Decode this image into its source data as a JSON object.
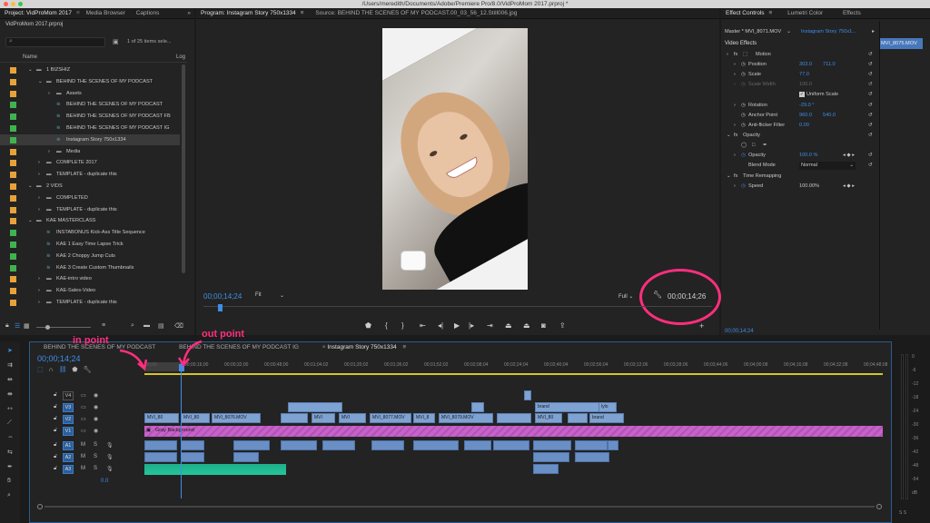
{
  "titlebar": {
    "path": "/Users/meredith/Documents/Adobe/Premiere Pro/8.0/VidProMom 2017.prproj *"
  },
  "project_panel": {
    "tabs": [
      "Project: VidProMom 2017",
      "Media Browser",
      "Captions"
    ],
    "file_name": "VidProMom 2017.prproj",
    "item_count": "1 of 25 items sele...",
    "col_name": "Name",
    "col_log": "Log",
    "rows": [
      {
        "label": "1 BIZSHIZ",
        "indent": 1,
        "type": "folder",
        "open": true,
        "color": "#e8a23a"
      },
      {
        "label": "BEHIND THE SCENES OF MY PODCAST",
        "indent": 2,
        "type": "folder",
        "open": true,
        "color": "#e8a23a"
      },
      {
        "label": "Assets",
        "indent": 3,
        "type": "folder",
        "open": false,
        "color": "#e8a23a"
      },
      {
        "label": "BEHIND THE SCENES OF MY PODCAST",
        "indent": 3,
        "type": "seq",
        "color": "#3fb34f"
      },
      {
        "label": "BEHIND THE SCENES OF MY PODCAST FB",
        "indent": 3,
        "type": "seq",
        "color": "#3fb34f"
      },
      {
        "label": "BEHIND THE SCENES OF MY PODCAST IG",
        "indent": 3,
        "type": "seq",
        "color": "#3fb34f"
      },
      {
        "label": "Instagram Story 750x1334",
        "indent": 3,
        "type": "seq",
        "color": "#3fb34f",
        "selected": true
      },
      {
        "label": "Media",
        "indent": 3,
        "type": "folder",
        "open": false,
        "color": "#e8a23a"
      },
      {
        "label": "COMPLETE 2017",
        "indent": 2,
        "type": "folder",
        "open": false,
        "color": "#e8a23a"
      },
      {
        "label": "TEMPLATE - duplicate this",
        "indent": 2,
        "type": "folder",
        "open": false,
        "color": "#e8a23a"
      },
      {
        "label": "2 VIDS",
        "indent": 1,
        "type": "folder",
        "open": true,
        "color": "#e8a23a"
      },
      {
        "label": "COMPLETED",
        "indent": 2,
        "type": "folder",
        "open": false,
        "color": "#e8a23a"
      },
      {
        "label": "TEMPLATE - duplicate this",
        "indent": 2,
        "type": "folder",
        "open": false,
        "color": "#e8a23a"
      },
      {
        "label": "KAE MASTERCLASS",
        "indent": 1,
        "type": "folder",
        "open": true,
        "color": "#e8a23a"
      },
      {
        "label": "INSTABONUS Kick-Ass Title Sequence",
        "indent": 2,
        "type": "seq",
        "color": "#3fb34f"
      },
      {
        "label": "KAE 1 Easy Time Lapse Trick",
        "indent": 2,
        "type": "seq",
        "color": "#3fb34f"
      },
      {
        "label": "KAE 2 Choppy Jump Cuts",
        "indent": 2,
        "type": "seq",
        "color": "#3fb34f"
      },
      {
        "label": "KAE 3 Create Custom Thumbnails",
        "indent": 2,
        "type": "seq",
        "color": "#3fb34f"
      },
      {
        "label": "KAE-intro video",
        "indent": 2,
        "type": "folder",
        "open": false,
        "color": "#e8a23a"
      },
      {
        "label": "KAE-Sales-Video",
        "indent": 2,
        "type": "folder",
        "open": false,
        "color": "#e8a23a"
      },
      {
        "label": "TEMPLATE - duplicate this",
        "indent": 2,
        "type": "folder",
        "open": false,
        "color": "#e8a23a"
      }
    ]
  },
  "program_monitor": {
    "tab_program": "Program: Instagram Story 750x1334",
    "tab_source": "Source: BEHIND THE SCENES OF MY PODCAST.00_03_56_12.Still006.jpg",
    "timecode_left": "00;00;14;24",
    "fit": "Fit",
    "quality": "Full",
    "timecode_right": "00;00;14;26"
  },
  "effect_controls": {
    "tabs": [
      "Effect Controls",
      "Lumetri Color",
      "Effects"
    ],
    "master": "Master * MVI_8071.MOV",
    "sequence": "Instagram Story 750x1...",
    "clip_chip": "MVI_8075.MOV",
    "video_effects": "Video Effects",
    "motion": "Motion",
    "position_label": "Position",
    "position_x": "303.0",
    "position_y": "711.0",
    "scale_label": "Scale",
    "scale_value": "77.0",
    "scale_width_label": "Scale Width",
    "scale_width_value": "100.0",
    "uniform_scale": "Uniform Scale",
    "rotation_label": "Rotation",
    "rotation_value": "-29.0 °",
    "anchor_label": "Anchor Point",
    "anchor_x": "960.0",
    "anchor_y": "540.0",
    "flicker_label": "Anti-flicker Filter",
    "flicker_value": "0.00",
    "opacity_section": "Opacity",
    "opacity_label": "Opacity",
    "opacity_value": "100.0 %",
    "blend_label": "Blend Mode",
    "blend_value": "Normal",
    "time_remap": "Time Remapping",
    "speed_label": "Speed",
    "speed_value": "100.00%",
    "bottom_timecode": "00;00;14;24"
  },
  "timeline": {
    "tabs": [
      "BEHIND THE SCENES OF MY PODCAST",
      "BEHIND THE SCENES OF MY PODCAST IG",
      "Instagram Story 750x1334"
    ],
    "timecode": "00;00;14;24",
    "ruler": [
      ":00;00",
      "00;00;16;00",
      "00;00;32;00",
      "00;00;48;00",
      "00;01;04;02",
      "00;01;20;02",
      "00;01;36;02",
      "00;01;52;02",
      "00;02;08;04",
      "00;02;24;04",
      "00;02;40;04",
      "00;02;56;04",
      "00;03;12;06",
      "00;03;28;06",
      "00;03;44;06",
      "00;04;00;08",
      "00;04;16;08",
      "00;04;32;08",
      "00;04;48;08"
    ],
    "tracks_video": [
      "V4",
      "V3",
      "V2",
      "V1"
    ],
    "tracks_audio": [
      "A1",
      "A2",
      "A3"
    ],
    "master_level": "0.0",
    "clip_labels": [
      "MVI_80",
      "MVI_80",
      "MVI_8076.MOV",
      "MVI",
      "MVI",
      "MVI_8077.MOV",
      "MVI_8",
      "MVI_8079.MOV",
      "MVI_80",
      "brand",
      "lylo"
    ],
    "gray_bg": "Gray Background",
    "meter_scale": [
      "0",
      "-6",
      "-12",
      "-18",
      "-24",
      "-30",
      "-36",
      "-42",
      "-48",
      "-54",
      "dB"
    ],
    "meter_bottom": "S S"
  },
  "annotations": {
    "in_point": "in point",
    "out_point": "out point"
  }
}
